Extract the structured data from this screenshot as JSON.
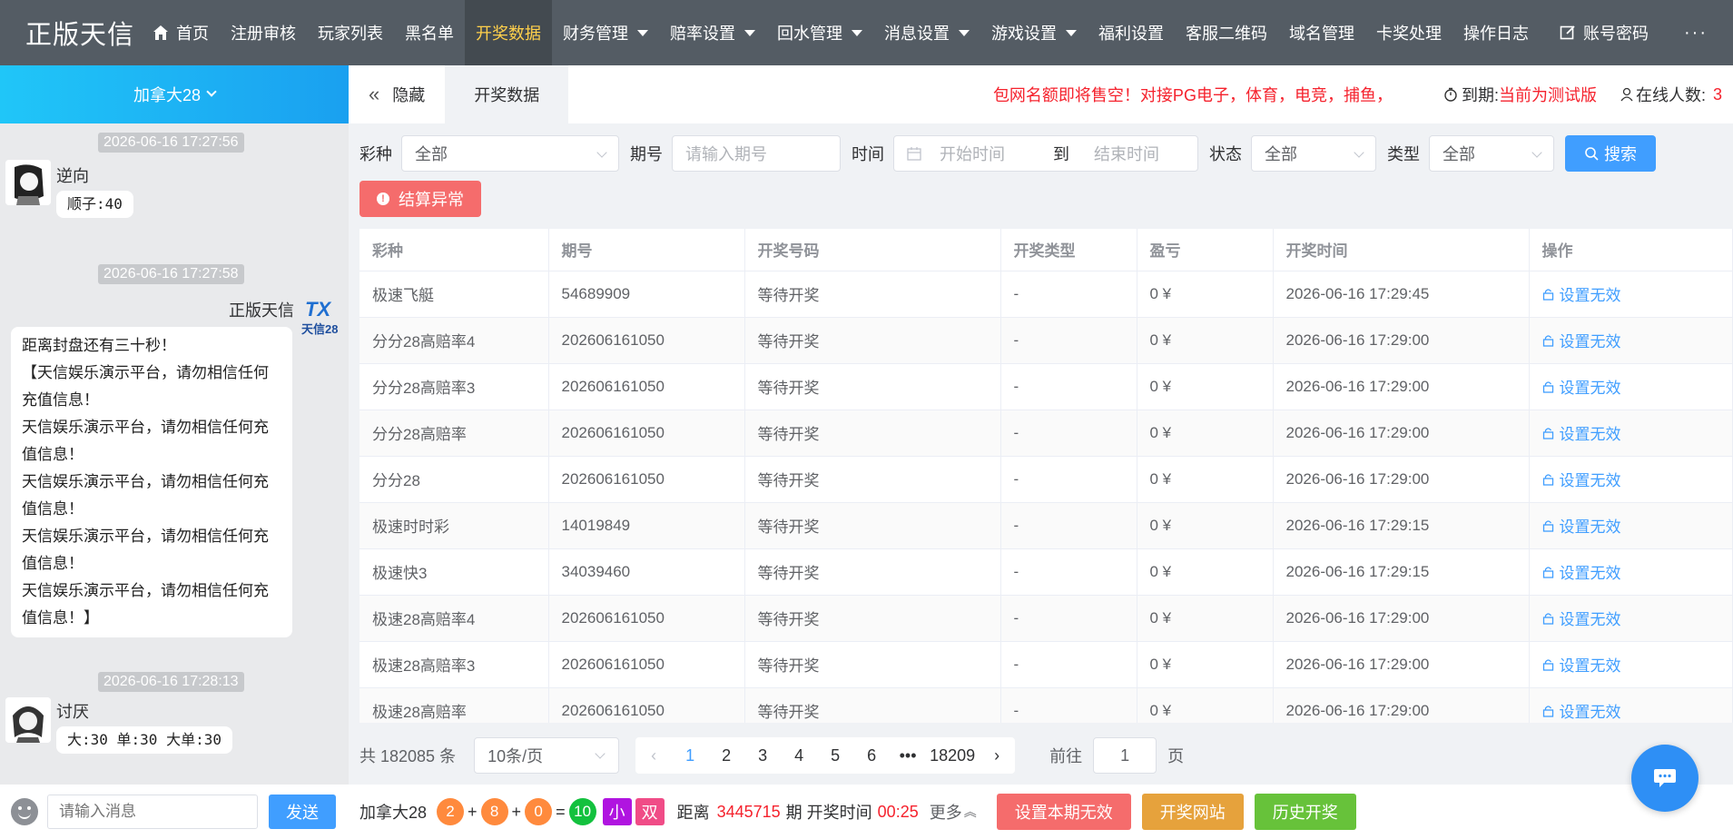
{
  "app": {
    "logo": "正版天信"
  },
  "nav": {
    "items": [
      {
        "label": "首页",
        "icon": "home-icon"
      },
      {
        "label": "注册审核"
      },
      {
        "label": "玩家列表"
      },
      {
        "label": "黑名单"
      },
      {
        "label": "开奖数据",
        "active": true
      },
      {
        "label": "财务管理",
        "dropdown": true
      },
      {
        "label": "赔率设置",
        "dropdown": true
      },
      {
        "label": "回水管理",
        "dropdown": true
      },
      {
        "label": "消息设置",
        "dropdown": true
      },
      {
        "label": "游戏设置",
        "dropdown": true
      },
      {
        "label": "福利设置"
      },
      {
        "label": "客服二维码"
      },
      {
        "label": "域名管理"
      },
      {
        "label": "卡奖处理"
      },
      {
        "label": "操作日志"
      },
      {
        "label": "账号密码",
        "icon": "edit-icon"
      }
    ],
    "more": "···"
  },
  "sidebar": {
    "game": "加拿大28",
    "messages": [
      {
        "time": "2026-06-16 17:27:56",
        "user": "逆向",
        "text": "顺子:40"
      },
      {
        "time": "2026-06-16 17:27:58",
        "user": "正版天信",
        "avatar_text": "天信28",
        "lines": [
          "距离封盘还有三十秒！",
          "【天信娱乐演示平台，请勿相信任何充值信息！",
          "天信娱乐演示平台，请勿相信任何充值信息！",
          "天信娱乐演示平台，请勿相信任何充值信息！",
          "天信娱乐演示平台，请勿相信任何充值信息！",
          "天信娱乐演示平台，请勿相信任何充值信息！】"
        ]
      },
      {
        "time": "2026-06-16 17:28:13",
        "user": "讨厌",
        "text": "大:30 单:30 大单:30"
      }
    ],
    "input_placeholder": "请输入消息",
    "send_label": "发送"
  },
  "tabs": {
    "hide_label": "隐藏",
    "current": "开奖数据"
  },
  "header": {
    "notice": "包网名额即将售空！对接PG电子，体育，电竞，捕鱼，",
    "expire_label": "到期:",
    "expire_value": "当前为测试版",
    "online_label": "在线人数:",
    "online_value": "3"
  },
  "filters": {
    "lottery_label": "彩种",
    "lottery_value": "全部",
    "issue_label": "期号",
    "issue_placeholder": "请输入期号",
    "time_label": "时间",
    "start_placeholder": "开始时间",
    "to": "到",
    "end_placeholder": "结束时间",
    "status_label": "状态",
    "status_value": "全部",
    "type_label": "类型",
    "type_value": "全部",
    "search_label": "搜索",
    "abnormal_label": "结算异常"
  },
  "table": {
    "headers": [
      "彩种",
      "期号",
      "开奖号码",
      "开奖类型",
      "盈亏",
      "开奖时间",
      "操作"
    ],
    "rows": [
      [
        "极速飞艇",
        "54689909",
        "等待开奖",
        "-",
        "0 ¥",
        "2026-06-16 17:29:45",
        "设置无效"
      ],
      [
        "分分28高赔率4",
        "202606161050",
        "等待开奖",
        "-",
        "0 ¥",
        "2026-06-16 17:29:00",
        "设置无效"
      ],
      [
        "分分28高赔率3",
        "202606161050",
        "等待开奖",
        "-",
        "0 ¥",
        "2026-06-16 17:29:00",
        "设置无效"
      ],
      [
        "分分28高赔率",
        "202606161050",
        "等待开奖",
        "-",
        "0 ¥",
        "2026-06-16 17:29:00",
        "设置无效"
      ],
      [
        "分分28",
        "202606161050",
        "等待开奖",
        "-",
        "0 ¥",
        "2026-06-16 17:29:00",
        "设置无效"
      ],
      [
        "极速时时彩",
        "14019849",
        "等待开奖",
        "-",
        "0 ¥",
        "2026-06-16 17:29:15",
        "设置无效"
      ],
      [
        "极速快3",
        "34039460",
        "等待开奖",
        "-",
        "0 ¥",
        "2026-06-16 17:29:15",
        "设置无效"
      ],
      [
        "极速28高赔率4",
        "202606161050",
        "等待开奖",
        "-",
        "0 ¥",
        "2026-06-16 17:29:00",
        "设置无效"
      ],
      [
        "极速28高赔率3",
        "202606161050",
        "等待开奖",
        "-",
        "0 ¥",
        "2026-06-16 17:29:00",
        "设置无效"
      ],
      [
        "极速28高赔率",
        "202606161050",
        "等待开奖",
        "-",
        "0 ¥",
        "2026-06-16 17:29:00",
        "设置无效"
      ]
    ]
  },
  "pagination": {
    "total": "共 182085 条",
    "page_size": "10条/页",
    "pages": [
      "1",
      "2",
      "3",
      "4",
      "5",
      "6",
      "•••",
      "18209"
    ],
    "current": "1",
    "goto_label": "前往",
    "goto_value": "1",
    "page_suffix": "页"
  },
  "bottom": {
    "game": "加拿大28",
    "balls": [
      "2",
      "8",
      "0"
    ],
    "sum": "10",
    "size_tag": "小",
    "parity_tag": "双",
    "distance_label": "距离",
    "issue": "3445715",
    "period_label": "期 开奖时间",
    "countdown": "00:25",
    "more_label": "更多",
    "btn_invalid": "设置本期无效",
    "btn_site": "开奖网站",
    "btn_history": "历史开奖"
  },
  "colors": {
    "primary": "#409eff",
    "danger": "#f56c6c",
    "warning": "#e6a23c",
    "success": "#67c23a",
    "nav_bg": "#545c64",
    "active_text": "#ffd04b"
  }
}
